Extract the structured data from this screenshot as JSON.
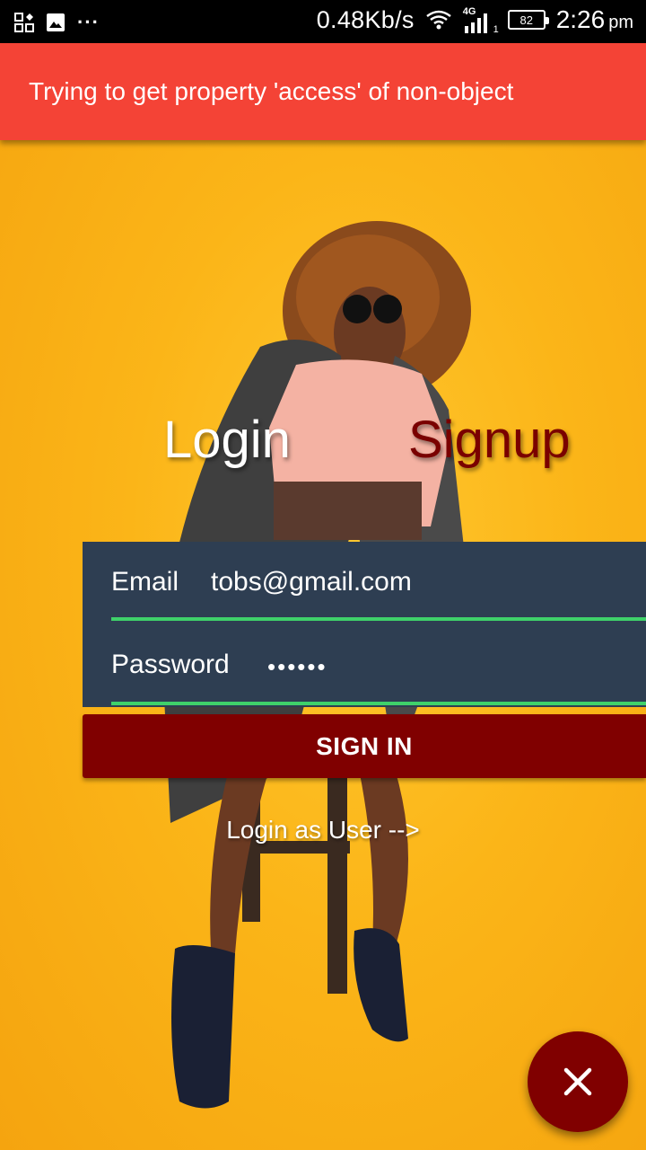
{
  "status_bar": {
    "icons_left": [
      "qr-grid-icon",
      "image-icon",
      "more-dots-icon"
    ],
    "more_label": "···",
    "network_speed": "0.48Kb/s",
    "network_type": "4G",
    "sim_slot": "1",
    "battery_level": "82",
    "time": "2:26",
    "time_suffix": "pm"
  },
  "error": {
    "message": "Trying to get property 'access' of non-object",
    "color": "#f44336"
  },
  "tabs": {
    "login_label": "Login",
    "signup_label": "Signup"
  },
  "form": {
    "email_label": "Email",
    "email_value": "tobs@gmail.com",
    "password_label": "Password",
    "password_value": "••••••",
    "underline_color": "#3fd16a",
    "card_color": "#2e3e52"
  },
  "actions": {
    "signin_label": "SIGN IN",
    "user_link_label": "Login as User -->",
    "fab_icon": "close-icon",
    "accent_color": "#800000"
  }
}
